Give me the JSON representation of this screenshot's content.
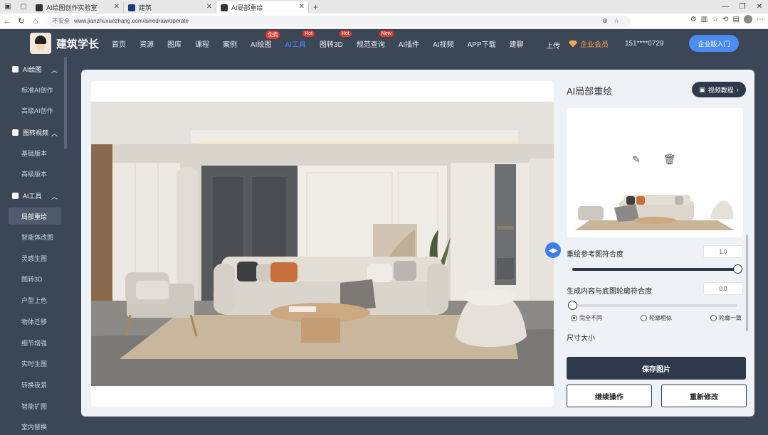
{
  "browser": {
    "tabs": [
      {
        "title": "AI绘图创作实验室"
      },
      {
        "title": "建筑"
      },
      {
        "title": "AI局部重绘"
      }
    ],
    "url_security": "不安全",
    "url": "www.jianzhuxuezhang.com/ai/redraw/operate"
  },
  "header": {
    "brand": "建筑学长",
    "nav": [
      {
        "label": "首页"
      },
      {
        "label": "资源"
      },
      {
        "label": "图库"
      },
      {
        "label": "课程"
      },
      {
        "label": "案例"
      },
      {
        "label": "AI绘图",
        "badge": "免费"
      },
      {
        "label": "AI工具",
        "badge": "Hot"
      },
      {
        "label": "图转3D",
        "badge": "Hot"
      },
      {
        "label": "规范查询",
        "badge": "New"
      },
      {
        "label": "AI插件"
      },
      {
        "label": "AI视频"
      },
      {
        "label": "APP下载"
      },
      {
        "label": "建聊"
      }
    ],
    "upload": "上传",
    "vip": "企业会员",
    "phone": "151****0729",
    "enterprise_button": "企业版入门"
  },
  "sidebar": {
    "groups": [
      {
        "label": "AI绘图",
        "items": [
          "标准AI创作",
          "高级AI创作"
        ]
      },
      {
        "label": "图转视频",
        "items": [
          "基础版本",
          "高级版本"
        ]
      },
      {
        "label": "AI工具",
        "items": [
          "局部重绘",
          "智能体改图",
          "灵感生图",
          "图转3D",
          "户型上色",
          "物体迁移",
          "细节增强",
          "实时生图",
          "转换夜景",
          "智能扩图",
          "室内替换"
        ]
      }
    ],
    "active_item": "局部重绘"
  },
  "panel": {
    "title": "AI局部重绘",
    "video_button": "视频教程",
    "ref_match_label": "重绘参考图符合度",
    "ref_match_value": "1.0",
    "ref_match_fraction": 1.0,
    "outline_match_label": "生成内容与底图轮廓符合度",
    "outline_match_value": "0.0",
    "outline_match_fraction": 0.0,
    "radio_options": [
      "完全不同",
      "轮廓相似",
      "轮廓一致"
    ],
    "radio_selected": "完全不同",
    "size_label": "尺寸大小",
    "save_button": "保存图片",
    "continue_button": "继续操作",
    "redo_button": "重新修改"
  },
  "colors": {
    "header_bg": "#3b4656",
    "accent": "#3d7bf0",
    "dark_button": "#2e3a4b",
    "badge_red": "#e23a2d",
    "vip_gold": "#f5a94a"
  }
}
